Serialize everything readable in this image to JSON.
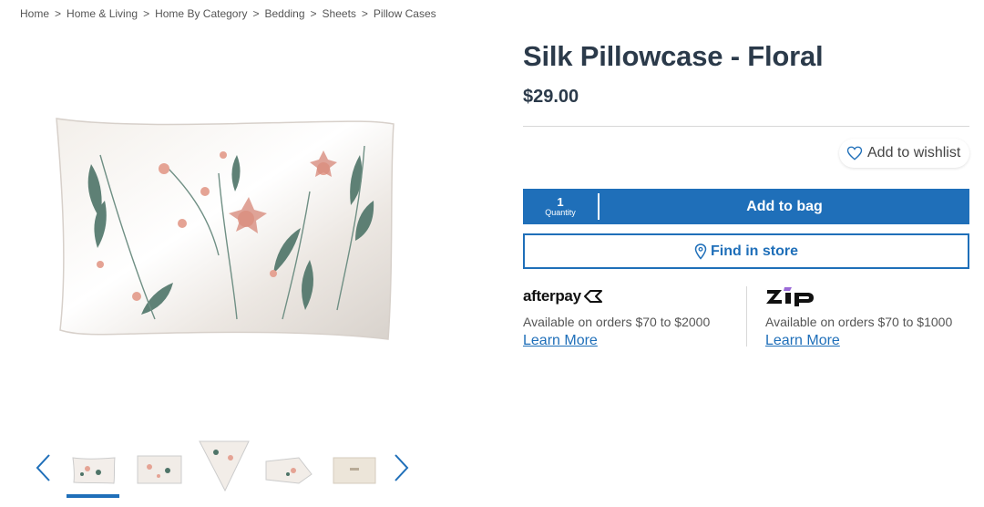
{
  "breadcrumb": {
    "items": [
      "Home",
      "Home & Living",
      "Home By Category",
      "Bedding",
      "Sheets",
      "Pillow Cases"
    ],
    "separator": ">"
  },
  "product": {
    "title": "Silk Pillowcase - Floral",
    "price": "$29.00"
  },
  "wishlist": {
    "label": "Add to wishlist",
    "icon": "heart-icon"
  },
  "cart": {
    "quantity": "1",
    "quantity_label": "Quantity",
    "add_label": "Add to bag"
  },
  "store": {
    "label": "Find in store",
    "icon": "location-pin-icon"
  },
  "payments": {
    "afterpay": {
      "logo_text": "afterpay",
      "available": "Available on orders $70 to $2000",
      "learn_more": "Learn More"
    },
    "zip": {
      "logo_text": "zip",
      "available": "Available on orders $70 to $1000",
      "learn_more": "Learn More"
    }
  },
  "gallery": {
    "thumbnail_count": 5,
    "selected_index": 0
  },
  "colors": {
    "accent": "#1f6fb9",
    "heading": "#2b3a4a",
    "text": "#555555"
  }
}
